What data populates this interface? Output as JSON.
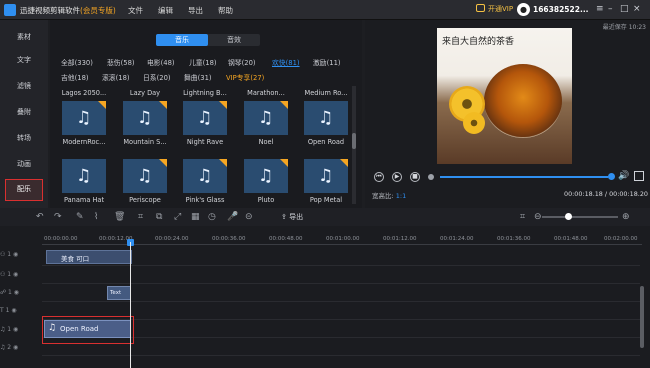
{
  "app": {
    "title": "迅捷视频剪辑软件",
    "badge": "(会员专版)"
  },
  "menu": [
    "文件",
    "编辑",
    "导出",
    "帮助"
  ],
  "vip": "开通VIP",
  "user": "166382522...",
  "window_controls": [
    "≡",
    "–",
    "□",
    "×"
  ],
  "sidebar": [
    "素材",
    "文字",
    "滤镜",
    "叠附",
    "转场",
    "动画",
    "配乐"
  ],
  "tabs": [
    "音乐",
    "音效"
  ],
  "categories_row1": [
    "全部(330)",
    "悲伤(58)",
    "电影(48)",
    "儿童(18)",
    "钢琴(20)",
    "欢快(81)",
    "激励(11)"
  ],
  "categories_row2": [
    "吉他(18)",
    "滚滚(18)",
    "日系(20)",
    "舞曲(31)",
    "VIP专享(27)"
  ],
  "grid_top_labels": [
    "Lagos 2050...",
    "Lazy Day",
    "Lightning B...",
    "Marathon...",
    "Medium Ro..."
  ],
  "grid_items": [
    {
      "label": "ModernRoc...",
      "vip": true
    },
    {
      "label": "Mountain S...",
      "vip": true
    },
    {
      "label": "Night Rave",
      "vip": true
    },
    {
      "label": "Noel",
      "vip": true
    },
    {
      "label": "Open Road",
      "vip": false
    },
    {
      "label": "Panama Hat",
      "vip": false
    },
    {
      "label": "Periscope",
      "vip": true
    },
    {
      "label": "Pink's Glass",
      "vip": true
    },
    {
      "label": "Pluto",
      "vip": true
    },
    {
      "label": "Pop Metal",
      "vip": true
    }
  ],
  "autosave": "最近保存 10:23",
  "preview": {
    "title": "来自大自然的茶香",
    "ratio_label": "宽高比:",
    "ratio": "1:1",
    "time": "00:00:18.18 / 00:00:18.20",
    "progress": 0.98
  },
  "toolbar": {
    "export": "导出"
  },
  "ruler": [
    "00:00:00.00",
    "00:00:12.00",
    "00:00:24.00",
    "00:00:36.00",
    "00:00:48.00",
    "00:01:00.00",
    "00:01:12.00",
    "00:01:24.00",
    "00:01:36.00",
    "00:01:48.00",
    "00:02:00.00"
  ],
  "tracks": [
    "1",
    "1",
    "1",
    "1",
    "1",
    "2"
  ],
  "clips": {
    "video": "美食 可口",
    "text": "Text",
    "audio": "Open Road"
  },
  "colors": {
    "accent": "#2f8ff0",
    "vip": "#f5a623",
    "selection": "#d93030"
  }
}
